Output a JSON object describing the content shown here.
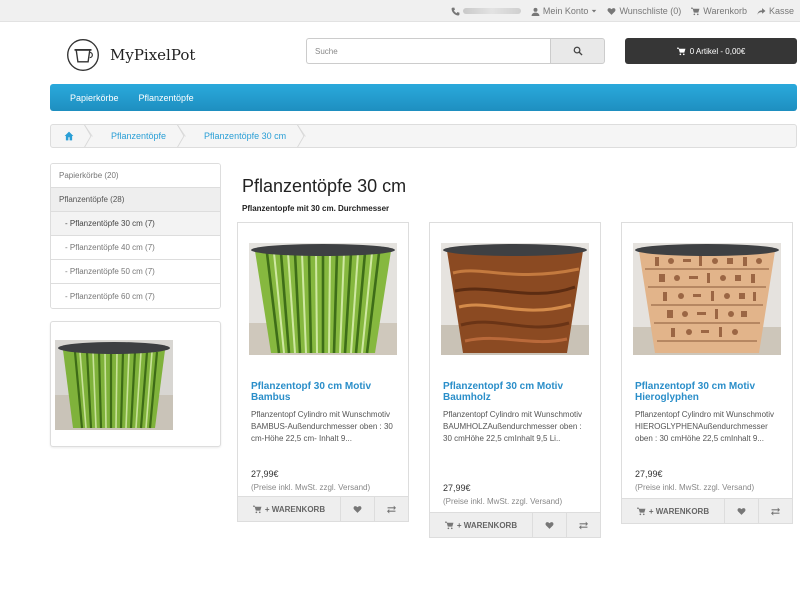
{
  "topbar": {
    "account_label": "Mein Konto",
    "wishlist_label": "Wunschliste (0)",
    "cart_label": "Warenkorb",
    "checkout_label": "Kasse"
  },
  "brand": {
    "name": "MyPixelPot"
  },
  "search": {
    "placeholder": "Suche"
  },
  "cart_button": {
    "label": "0 Artikel - 0,00€"
  },
  "nav": {
    "items": [
      "Papierkörbe",
      "Pflanzentöpfe"
    ]
  },
  "breadcrumb": {
    "items": [
      "Pflanzentöpfe",
      "Pflanzentöpfe 30 cm"
    ]
  },
  "sidebar": {
    "categories": [
      "Papierkörbe (20)",
      "Pflanzentöpfe (28)",
      "- Pflanzentöpfe 30 cm (7)",
      "- Pflanzentöpfe 40 cm (7)",
      "- Pflanzentöpfe 50 cm (7)",
      "- Pflanzentöpfe 60 cm (7)"
    ]
  },
  "page": {
    "title": "Pflanzentöpfe 30 cm",
    "subtitle": "Pflanzentopfe mit 30 cm. Durchmesser"
  },
  "products": [
    {
      "name": "Pflanzentopf 30 cm Motiv Bambus",
      "desc": "Pflanzentopf Cylindro mit Wunschmotiv BAMBUS-Außendurchmesser oben : 30 cm-Höhe 22,5 cm- Inhalt 9...",
      "price": "27,99€",
      "tax": "(Preise inkl. MwSt. zzgl. Versand)",
      "cart_label": "+ WARENKORB"
    },
    {
      "name": "Pflanzentopf 30 cm Motiv Baumholz",
      "desc": "Pflanzentopf Cylindro mit Wunschmotiv BAUMHOLZAußendurchmesser oben : 30 cmHöhe 22,5 cmInhalt 9,5 Li..",
      "price": "27,99€",
      "tax": "(Preise inkl. MwSt. zzgl. Versand)",
      "cart_label": "+ WARENKORB"
    },
    {
      "name": "Pflanzentopf 30 cm Motiv Hieroglyphen",
      "desc": "Pflanzentopf Cylindro mit Wunschmotiv HIEROGLYPHENAußendurchmesser oben : 30 cmHöhe 22,5 cmInhalt 9...",
      "price": "27,99€",
      "tax": "(Preise inkl. MwSt. zzgl. Versand)",
      "cart_label": "+ WARENKORB"
    }
  ]
}
